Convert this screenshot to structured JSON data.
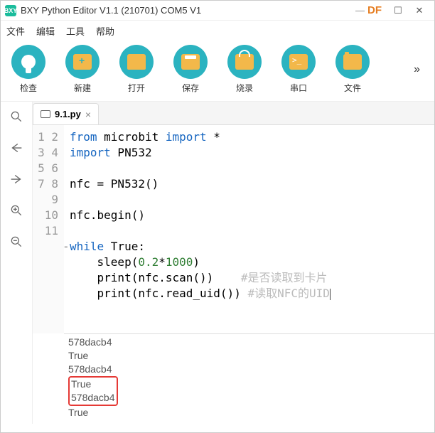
{
  "window": {
    "title": "BXY Python Editor V1.1 (210701) COM5 V1",
    "df": "DF"
  },
  "menu": {
    "file": "文件",
    "edit": "编辑",
    "tool": "工具",
    "help": "帮助"
  },
  "toolbar": {
    "check": "检查",
    "new": "新建",
    "open": "打开",
    "save": "保存",
    "burn": "烧录",
    "serial": "串口",
    "file": "文件",
    "more": "»"
  },
  "tab": {
    "name": "9.1.py",
    "close": "×"
  },
  "code": {
    "lines": [
      "1",
      "2",
      "3",
      "4",
      "5",
      "6",
      "7",
      "8",
      "9",
      "10",
      "11"
    ],
    "l1a": "from",
    "l1b": " microbit ",
    "l1c": "import",
    "l1d": " *",
    "l2a": "import",
    "l2b": " PN532",
    "l4": "nfc = PN532()",
    "l6": "nfc.begin()",
    "l8a": "while",
    "l8b": " True:",
    "l9a": "    sleep(",
    "l9b": "0.2",
    "l9c": "*",
    "l9d": "1000",
    "l9e": ")",
    "l10a": "    print(nfc.scan())    ",
    "l10b": "#是否读取到卡片",
    "l11a": "    print(nfc.read_uid()) ",
    "l11b": "#读取NFC的UID"
  },
  "console": {
    "r1": "578dacb4",
    "r2": "True",
    "r3": "578dacb4",
    "r4": "True",
    "r5": "578dacb4",
    "r6": "True"
  }
}
